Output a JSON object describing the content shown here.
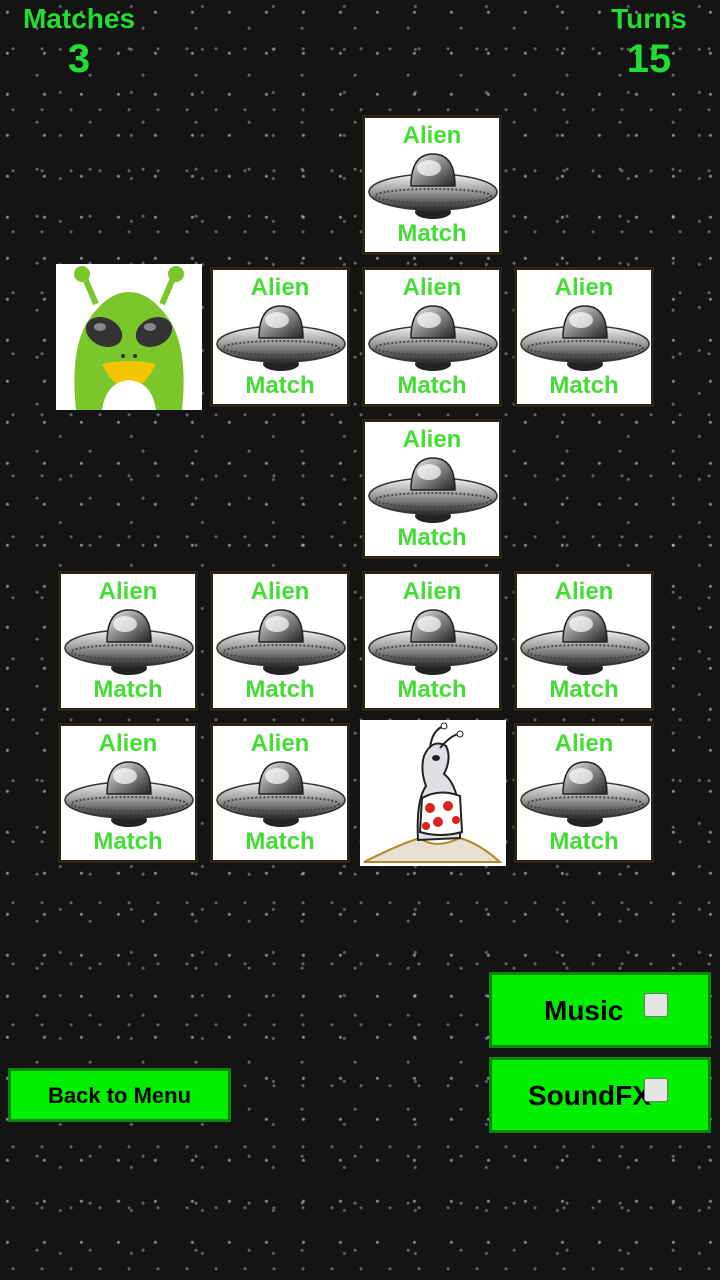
{
  "hud": {
    "matches_label": "Matches",
    "matches_value": "3",
    "turns_label": "Turns",
    "turns_value": "15"
  },
  "card_back": {
    "top_text": "Alien",
    "bottom_text": "Match"
  },
  "revealed_cards": [
    "green-alien",
    "slug-alien"
  ],
  "buttons": {
    "back": "Back to Menu",
    "music": "Music",
    "soundfx": "SoundFX"
  },
  "settings": {
    "music_checked": false,
    "soundfx_checked": false
  },
  "colors": {
    "accent_green": "#00ee00",
    "text_green": "#44dd33",
    "hud_green": "#22dd33"
  }
}
